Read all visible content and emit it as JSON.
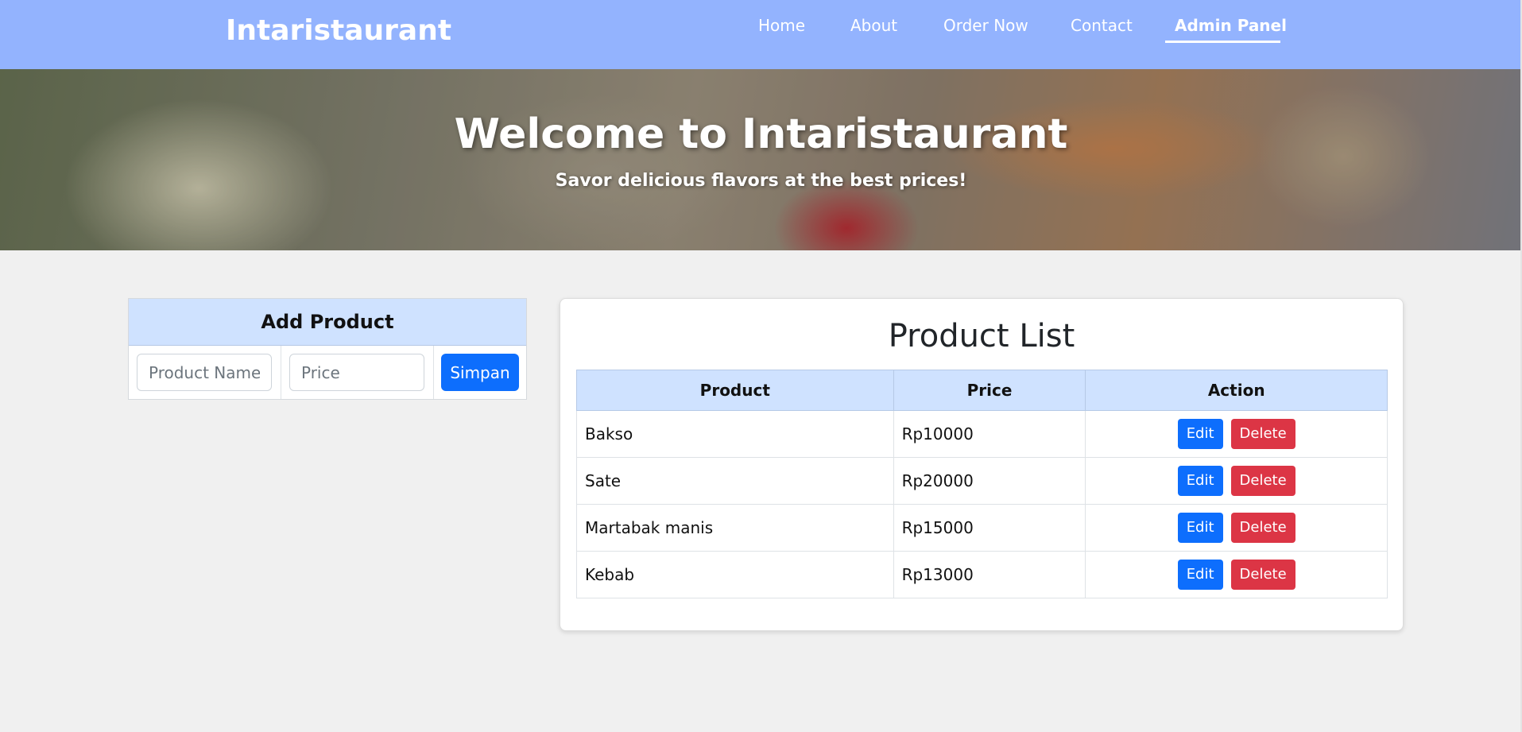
{
  "navbar": {
    "brand": "Intaristaurant",
    "links": [
      {
        "label": "Home",
        "active": false
      },
      {
        "label": "About",
        "active": false
      },
      {
        "label": "Order Now",
        "active": false
      },
      {
        "label": "Contact",
        "active": false
      },
      {
        "label": "Admin Panel",
        "active": true
      }
    ],
    "background_color": "#93b3fe"
  },
  "hero": {
    "title": "Welcome to Intaristaurant",
    "subtitle": "Savor delicious flavors at the best prices!"
  },
  "add_product": {
    "title": "Add Product",
    "name_placeholder": "Product Name",
    "name_value": "",
    "price_placeholder": "Price",
    "price_value": "",
    "submit_label": "Simpan"
  },
  "product_list": {
    "title": "Product List",
    "columns": [
      "Product",
      "Price",
      "Action"
    ],
    "rows": [
      {
        "product": "Bakso",
        "price": "Rp10000"
      },
      {
        "product": "Sate",
        "price": "Rp20000"
      },
      {
        "product": "Martabak manis",
        "price": "Rp15000"
      },
      {
        "product": "Kebab",
        "price": "Rp13000"
      }
    ],
    "edit_label": "Edit",
    "delete_label": "Delete"
  },
  "colors": {
    "primary": "#0d6efd",
    "danger": "#dc3545",
    "table_header": "#cfe2ff",
    "page_background": "#f0f0f0"
  }
}
